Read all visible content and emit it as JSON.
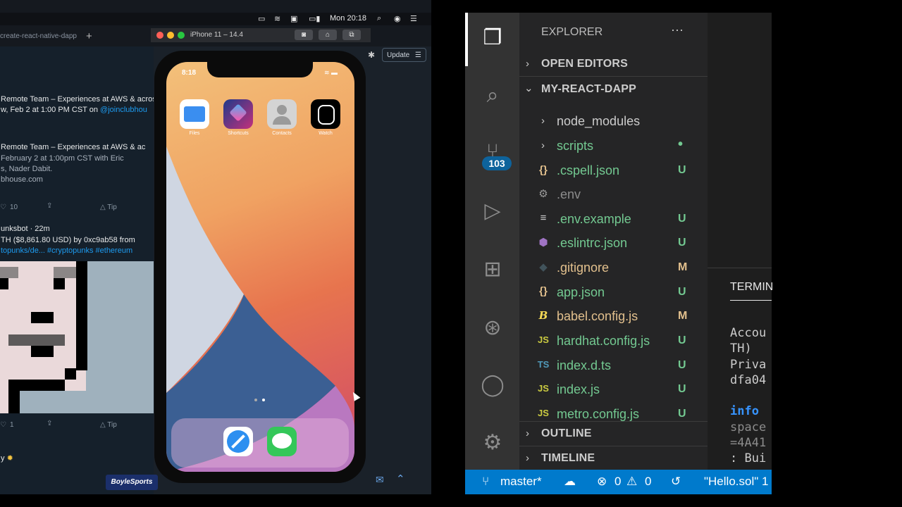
{
  "menubar": {
    "clock": "Mon 20:18"
  },
  "browser": {
    "tab_title": "create-react-native-dapp",
    "new_tab": "+",
    "update_label": "Update"
  },
  "tweets": {
    "line1": "Remote Team – Experiences at AWS & across",
    "line2_prefix": "w, Feb 2 at 1:00 PM CST on ",
    "line2_link": "@joinclubhou",
    "line3": "Remote Team – Experiences at AWS & ac",
    "line4": "February 2 at 1:00pm CST with Eric",
    "line5": "s, Nader Dabit.",
    "line6": "bhouse.com",
    "likes1": "10",
    "tip": "Tip",
    "author": "unksbot · 22m",
    "sale": "TH ($8,861.80 USD) by 0xc9ab58 from",
    "hashtags": "topunks/de... #cryptopunks #ethereum",
    "likes2": "1",
    "footer_word": "y",
    "sponsor": "BoyleSports"
  },
  "simulator": {
    "title": "iPhone 11 – 14.4",
    "status_time": "8:18",
    "apps": [
      "Files",
      "Shortcuts",
      "Contacts",
      "Watch"
    ]
  },
  "vscode": {
    "explorer_title": "EXPLORER",
    "more": "···",
    "open_editors": "OPEN EDITORS",
    "project": "MY-REACT-DAPP",
    "files": [
      {
        "name": "node_modules",
        "status": ""
      },
      {
        "name": "scripts",
        "status": "•"
      },
      {
        "name": ".cspell.json",
        "status": "U"
      },
      {
        "name": ".env",
        "status": ""
      },
      {
        "name": ".env.example",
        "status": "U"
      },
      {
        "name": ".eslintrc.json",
        "status": "U"
      },
      {
        "name": ".gitignore",
        "status": "M"
      },
      {
        "name": "app.json",
        "status": "U"
      },
      {
        "name": "babel.config.js",
        "status": "M"
      },
      {
        "name": "hardhat.config.js",
        "status": "U"
      },
      {
        "name": "index.d.ts",
        "status": "U"
      },
      {
        "name": "index.js",
        "status": "U"
      },
      {
        "name": "metro.config.js",
        "status": "U"
      }
    ],
    "outline": "OUTLINE",
    "timeline": "TIMELINE",
    "scm_badge": "103",
    "terminal_tab": "TERMIN",
    "terminal_lines": [
      "Accou",
      "TH)",
      "Priva",
      "dfa04",
      "info ",
      "space",
      "=4A41",
      ": Bui"
    ],
    "status": {
      "branch": "master*",
      "errors": "0",
      "warnings": "0",
      "file": "\"Hello.sol\" 1"
    }
  },
  "colors": {
    "accent": "#007acc",
    "untracked": "#73c991",
    "modified": "#e2c08d"
  }
}
